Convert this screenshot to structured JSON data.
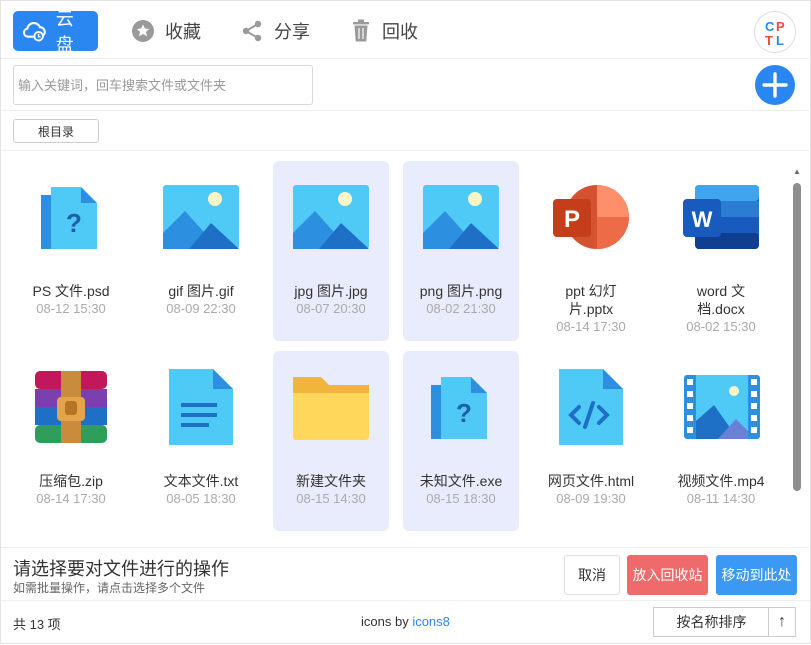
{
  "tabs": [
    {
      "label": "云盘",
      "icon": "cloud-icon",
      "active": true
    },
    {
      "label": "收藏",
      "icon": "star-icon",
      "active": false
    },
    {
      "label": "分享",
      "icon": "share-icon",
      "active": false
    },
    {
      "label": "回收",
      "icon": "trash-icon",
      "active": false
    }
  ],
  "avatar": {
    "text": "CPTL"
  },
  "search": {
    "placeholder": "输入关键词，回车搜索文件或文件夹",
    "value": ""
  },
  "breadcrumb": {
    "root": "根目录"
  },
  "files": [
    {
      "name": "PS 文件.psd",
      "time": "08-12 15:30",
      "icon": "unknown-file-icon",
      "selected": false
    },
    {
      "name": "gif 图片.gif",
      "time": "08-09 22:30",
      "icon": "image-icon",
      "selected": false
    },
    {
      "name": "jpg 图片.jpg",
      "time": "08-07 20:30",
      "icon": "image-icon",
      "selected": true
    },
    {
      "name": "png 图片.png",
      "time": "08-02 21:30",
      "icon": "image-icon",
      "selected": true
    },
    {
      "name": "ppt 幻灯片.pptx",
      "time": "08-14 17:30",
      "icon": "powerpoint-icon",
      "selected": false
    },
    {
      "name": "word 文档.docx",
      "time": "08-02 15:30",
      "icon": "word-icon",
      "selected": false
    },
    {
      "name": "压缩包.zip",
      "time": "08-14 17:30",
      "icon": "archive-icon",
      "selected": false
    },
    {
      "name": "文本文件.txt",
      "time": "08-05 18:30",
      "icon": "text-file-icon",
      "selected": false
    },
    {
      "name": "新建文件夹",
      "time": "08-15 14:30",
      "icon": "folder-icon",
      "selected": true
    },
    {
      "name": "未知文件.exe",
      "time": "08-15 18:30",
      "icon": "unknown-file-icon",
      "selected": true
    },
    {
      "name": "网页文件.html",
      "time": "08-09 19:30",
      "icon": "code-file-icon",
      "selected": false
    },
    {
      "name": "视频文件.mp4",
      "time": "08-11 14:30",
      "icon": "video-icon",
      "selected": false
    }
  ],
  "actionbar": {
    "title": "请选择要对文件进行的操作",
    "hint": "如需批量操作，请点击选择多个文件",
    "cancel": "取消",
    "recycle": "放入回收站",
    "move": "移动到此处"
  },
  "footer": {
    "count": "共 13 项",
    "credit_prefix": "icons by ",
    "credit_link": "icons8",
    "sort": "按名称排序",
    "sort_dir": "↑"
  },
  "colors": {
    "primary": "#2a86f0",
    "danger": "#ef6b6b",
    "selected_bg": "#e9ecfc"
  }
}
